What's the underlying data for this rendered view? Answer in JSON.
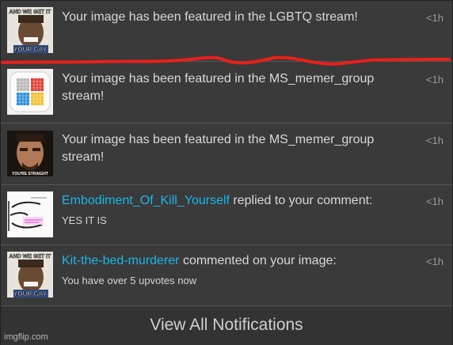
{
  "notifications": [
    {
      "thumbnail": "selfie-man-meme-thumbnail",
      "thumb_caption_top": "AND WE GET IT",
      "thumb_caption_bottom": "YOUR GAY",
      "message": "Your image has been featured in the LGBTQ stream!",
      "time": "<1h"
    },
    {
      "thumbnail": "color-grid-logo-thumbnail",
      "message_line1": "Your image has been featured in the MS_memer_group",
      "message_line2": "stream!",
      "time": "<1h"
    },
    {
      "thumbnail": "iron-man-meme-thumbnail",
      "thumb_caption": "YOU'RE STRAIGHT",
      "message_line1": "Your image has been featured in the MS_memer_group",
      "message_line2": "stream!",
      "time": "<1h"
    },
    {
      "thumbnail": "trollface-drawing-thumbnail",
      "user": "Embodiment_Of_Kill_Yourself",
      "action": " replied to your comment:",
      "comment": "YES IT IS",
      "time": "<1h"
    },
    {
      "thumbnail": "selfie-man-meme-thumbnail",
      "thumb_caption_top": "AND WE GET IT",
      "thumb_caption_bottom": "YOUR GAY",
      "user": "Kit-the-bed-murderer",
      "action": " commented on your image:",
      "comment": "You have over 5 upvotes now",
      "time": "<1h"
    }
  ],
  "footer": {
    "label": "View All Notifications"
  },
  "watermark": "imgflip.com",
  "colors": {
    "username": "#1bb6e8",
    "scribble": "#e8201a",
    "background": "#3a3a3a"
  }
}
